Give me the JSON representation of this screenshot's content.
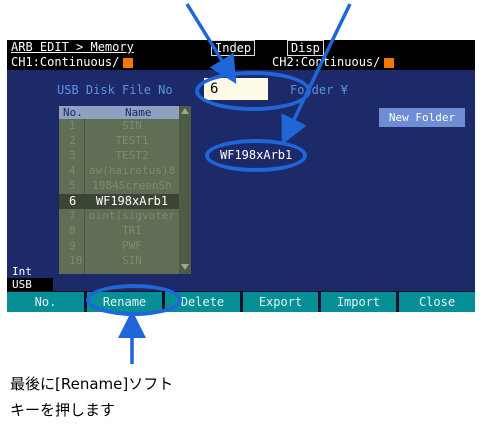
{
  "header": {
    "breadcrumb": "ARB EDIT > Memory",
    "indep_label": "Indep",
    "disp_label": "Disp",
    "ch1_status": "CH1:Continuous/",
    "ch2_status": "CH2:Continuous/"
  },
  "dialog": {
    "usb_title": "USB Disk File No",
    "file_no_value": "6",
    "folder_text": "Folder ¥",
    "new_folder_label": "New Folder",
    "selected_item": "WF198xArb1"
  },
  "file_list": {
    "col_no": "No.",
    "col_name": "Name",
    "rows": [
      {
        "no": "1",
        "name": "SIN"
      },
      {
        "no": "2",
        "name": "TEST1"
      },
      {
        "no": "3",
        "name": "TEST2"
      },
      {
        "no": "4",
        "name": "aw(hairetus)8"
      },
      {
        "no": "5",
        "name": "1984ScreenSh"
      },
      {
        "no": "6",
        "name": "WF198xArb1"
      },
      {
        "no": "7",
        "name": "oint(sigvoter"
      },
      {
        "no": "8",
        "name": "TRI"
      },
      {
        "no": "9",
        "name": "PWF"
      },
      {
        "no": "10",
        "name": "SIN"
      }
    ]
  },
  "storage": {
    "int_label": "Int",
    "usb_label": "USB"
  },
  "softkeys": {
    "no": "No.",
    "rename": "Rename",
    "delete": "Delete",
    "export": "Export",
    "import": "Import",
    "close": "Close"
  },
  "caption": {
    "line1": "最後に[Rename]ソフト",
    "line2": "キーを押します"
  },
  "colors": {
    "annotation": "#1f66d9",
    "screen_bg": "#1d2a6a",
    "softkey": "#078f97",
    "channel_marker": "#f07800"
  }
}
